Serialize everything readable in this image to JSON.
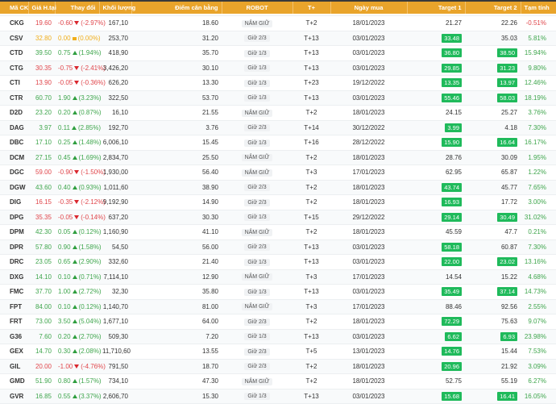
{
  "colors": {
    "header": "#e9a42b",
    "up": "#3fa64d",
    "down": "#e0464b",
    "flat": "#f0ae1b",
    "badge": "#1fba5b"
  },
  "headers": [
    "Mã CK",
    "Giá H.tại",
    "Thay đổi",
    "Khối lượng",
    "Điểm cân bằng",
    "ROBOT",
    "T+",
    "Ngày mua",
    "Target 1",
    "Target 2",
    "Tạm tính"
  ],
  "rows": [
    {
      "sym": "CKG",
      "price": "19.60",
      "chg": "-0.60",
      "pct": "(-2.97%)",
      "dir": "down",
      "vol": "167,10",
      "bal": "18.60",
      "robot": "NẮM GIỮ",
      "t": "T+2",
      "date": "18/01/2023",
      "t1": "21.27",
      "t1hit": false,
      "t2": "22.26",
      "t2hit": false,
      "pl": "-0.51%"
    },
    {
      "sym": "CSV",
      "price": "32.80",
      "chg": "0.00",
      "pct": "(0.00%)",
      "dir": "flat",
      "vol": "253,70",
      "bal": "31.20",
      "robot": "Giữ 2/3",
      "t": "T+13",
      "date": "03/01/2023",
      "t1": "33.48",
      "t1hit": true,
      "t2": "35.03",
      "t2hit": false,
      "pl": "5.81%"
    },
    {
      "sym": "CTD",
      "price": "39.50",
      "chg": "0.75",
      "pct": "(1.94%)",
      "dir": "up",
      "vol": "418,90",
      "bal": "35.70",
      "robot": "Giữ 1/3",
      "t": "T+13",
      "date": "03/01/2023",
      "t1": "36.80",
      "t1hit": true,
      "t2": "38.50",
      "t2hit": true,
      "pl": "15.94%"
    },
    {
      "sym": "CTG",
      "price": "30.35",
      "chg": "-0.75",
      "pct": "(-2.41%)",
      "dir": "down",
      "vol": "3,426,20",
      "bal": "30.10",
      "robot": "Giữ 1/3",
      "t": "T+13",
      "date": "03/01/2023",
      "t1": "29.85",
      "t1hit": true,
      "t2": "31.23",
      "t2hit": true,
      "pl": "9.80%"
    },
    {
      "sym": "CTI",
      "price": "13.90",
      "chg": "-0.05",
      "pct": "(-0.36%)",
      "dir": "down",
      "vol": "626,20",
      "bal": "13.30",
      "robot": "Giữ 1/3",
      "t": "T+23",
      "date": "19/12/2022",
      "t1": "13.35",
      "t1hit": true,
      "t2": "13.97",
      "t2hit": true,
      "pl": "12.46%"
    },
    {
      "sym": "CTR",
      "price": "60.70",
      "chg": "1.90",
      "pct": "(3.23%)",
      "dir": "up",
      "vol": "322,50",
      "bal": "53.70",
      "robot": "Giữ 1/3",
      "t": "T+13",
      "date": "03/01/2023",
      "t1": "55.46",
      "t1hit": true,
      "t2": "58.03",
      "t2hit": true,
      "pl": "18.19%"
    },
    {
      "sym": "D2D",
      "price": "23.20",
      "chg": "0.20",
      "pct": "(0.87%)",
      "dir": "up",
      "vol": "16,10",
      "bal": "21.55",
      "robot": "NẮM GIỮ",
      "t": "T+2",
      "date": "18/01/2023",
      "t1": "24.15",
      "t1hit": false,
      "t2": "25.27",
      "t2hit": false,
      "pl": "3.76%"
    },
    {
      "sym": "DAG",
      "price": "3.97",
      "chg": "0.11",
      "pct": "(2.85%)",
      "dir": "up",
      "vol": "192,70",
      "bal": "3.76",
      "robot": "Giữ 2/3",
      "t": "T+14",
      "date": "30/12/2022",
      "t1": "3.99",
      "t1hit": true,
      "t2": "4.18",
      "t2hit": false,
      "pl": "7.30%"
    },
    {
      "sym": "DBC",
      "price": "17.10",
      "chg": "0.25",
      "pct": "(1.48%)",
      "dir": "up",
      "vol": "6,006,10",
      "bal": "15.45",
      "robot": "Giữ 1/3",
      "t": "T+16",
      "date": "28/12/2022",
      "t1": "15.90",
      "t1hit": true,
      "t2": "16.64",
      "t2hit": true,
      "pl": "16.17%"
    },
    {
      "sym": "DCM",
      "price": "27.15",
      "chg": "0.45",
      "pct": "(1.69%)",
      "dir": "up",
      "vol": "2,834,70",
      "bal": "25.50",
      "robot": "NẮM GIỮ",
      "t": "T+2",
      "date": "18/01/2023",
      "t1": "28.76",
      "t1hit": false,
      "t2": "30.09",
      "t2hit": false,
      "pl": "1.95%"
    },
    {
      "sym": "DGC",
      "price": "59.00",
      "chg": "-0.90",
      "pct": "(-1.50%)",
      "dir": "down",
      "vol": "1,930,00",
      "bal": "56.40",
      "robot": "NẮM GIỮ",
      "t": "T+3",
      "date": "17/01/2023",
      "t1": "62.95",
      "t1hit": false,
      "t2": "65.87",
      "t2hit": false,
      "pl": "1.22%"
    },
    {
      "sym": "DGW",
      "price": "43.60",
      "chg": "0.40",
      "pct": "(0.93%)",
      "dir": "up",
      "vol": "1,011,60",
      "bal": "38.90",
      "robot": "Giữ 2/3",
      "t": "T+2",
      "date": "18/01/2023",
      "t1": "43.74",
      "t1hit": true,
      "t2": "45.77",
      "t2hit": false,
      "pl": "7.65%"
    },
    {
      "sym": "DIG",
      "price": "16.15",
      "chg": "-0.35",
      "pct": "(-2.12%)",
      "dir": "down",
      "vol": "9,192,90",
      "bal": "14.90",
      "robot": "Giữ 2/3",
      "t": "T+2",
      "date": "18/01/2023",
      "t1": "16.93",
      "t1hit": true,
      "t2": "17.72",
      "t2hit": false,
      "pl": "3.00%"
    },
    {
      "sym": "DPG",
      "price": "35.35",
      "chg": "-0.05",
      "pct": "(-0.14%)",
      "dir": "down",
      "vol": "637,20",
      "bal": "30.30",
      "robot": "Giữ 1/3",
      "t": "T+15",
      "date": "29/12/2022",
      "t1": "29.14",
      "t1hit": true,
      "t2": "30.49",
      "t2hit": true,
      "pl": "31.02%"
    },
    {
      "sym": "DPM",
      "price": "42.30",
      "chg": "0.05",
      "pct": "(0.12%)",
      "dir": "up",
      "vol": "1,160,90",
      "bal": "41.10",
      "robot": "NẮM GIỮ",
      "t": "T+2",
      "date": "18/01/2023",
      "t1": "45.59",
      "t1hit": false,
      "t2": "47.7",
      "t2hit": false,
      "pl": "0.21%"
    },
    {
      "sym": "DPR",
      "price": "57.80",
      "chg": "0.90",
      "pct": "(1.58%)",
      "dir": "up",
      "vol": "54,50",
      "bal": "56.00",
      "robot": "Giữ 2/3",
      "t": "T+13",
      "date": "03/01/2023",
      "t1": "58.18",
      "t1hit": true,
      "t2": "60.87",
      "t2hit": false,
      "pl": "7.30%"
    },
    {
      "sym": "DRC",
      "price": "23.05",
      "chg": "0.65",
      "pct": "(2.90%)",
      "dir": "up",
      "vol": "332,60",
      "bal": "21.40",
      "robot": "Giữ 1/3",
      "t": "T+13",
      "date": "03/01/2023",
      "t1": "22.00",
      "t1hit": true,
      "t2": "23.02",
      "t2hit": true,
      "pl": "13.16%"
    },
    {
      "sym": "DXG",
      "price": "14.10",
      "chg": "0.10",
      "pct": "(0.71%)",
      "dir": "up",
      "vol": "7,114,10",
      "bal": "12.90",
      "robot": "NẮM GIỮ",
      "t": "T+3",
      "date": "17/01/2023",
      "t1": "14.54",
      "t1hit": false,
      "t2": "15.22",
      "t2hit": false,
      "pl": "4.68%"
    },
    {
      "sym": "FMC",
      "price": "37.70",
      "chg": "1.00",
      "pct": "(2.72%)",
      "dir": "up",
      "vol": "32,30",
      "bal": "35.80",
      "robot": "Giữ 1/3",
      "t": "T+13",
      "date": "03/01/2023",
      "t1": "35.49",
      "t1hit": true,
      "t2": "37.14",
      "t2hit": true,
      "pl": "14.73%"
    },
    {
      "sym": "FPT",
      "price": "84.00",
      "chg": "0.10",
      "pct": "(0.12%)",
      "dir": "up",
      "vol": "1,140,70",
      "bal": "81.00",
      "robot": "NẮM GIỮ",
      "t": "T+3",
      "date": "17/01/2023",
      "t1": "88.46",
      "t1hit": false,
      "t2": "92.56",
      "t2hit": false,
      "pl": "2.55%"
    },
    {
      "sym": "FRT",
      "price": "73.00",
      "chg": "3.50",
      "pct": "(5.04%)",
      "dir": "up",
      "vol": "1,677,10",
      "bal": "64.00",
      "robot": "Giữ 2/3",
      "t": "T+2",
      "date": "18/01/2023",
      "t1": "72.29",
      "t1hit": true,
      "t2": "75.63",
      "t2hit": false,
      "pl": "9.07%"
    },
    {
      "sym": "G36",
      "price": "7.60",
      "chg": "0.20",
      "pct": "(2.70%)",
      "dir": "up",
      "vol": "509,30",
      "bal": "7.20",
      "robot": "Giữ 1/3",
      "t": "T+13",
      "date": "03/01/2023",
      "t1": "6.62",
      "t1hit": true,
      "t2": "6.93",
      "t2hit": true,
      "pl": "23.98%"
    },
    {
      "sym": "GEX",
      "price": "14.70",
      "chg": "0.30",
      "pct": "(2.08%)",
      "dir": "up",
      "vol": "11,710,60",
      "bal": "13.55",
      "robot": "Giữ 2/3",
      "t": "T+5",
      "date": "13/01/2023",
      "t1": "14.76",
      "t1hit": true,
      "t2": "15.44",
      "t2hit": false,
      "pl": "7.53%"
    },
    {
      "sym": "GIL",
      "price": "20.00",
      "chg": "-1.00",
      "pct": "(-4.76%)",
      "dir": "down",
      "vol": "791,50",
      "bal": "18.70",
      "robot": "Giữ 2/3",
      "t": "T+2",
      "date": "18/01/2023",
      "t1": "20.96",
      "t1hit": true,
      "t2": "21.92",
      "t2hit": false,
      "pl": "3.09%"
    },
    {
      "sym": "GMD",
      "price": "51.90",
      "chg": "0.80",
      "pct": "(1.57%)",
      "dir": "up",
      "vol": "734,10",
      "bal": "47.30",
      "robot": "NẮM GIỮ",
      "t": "T+2",
      "date": "18/01/2023",
      "t1": "52.75",
      "t1hit": false,
      "t2": "55.19",
      "t2hit": false,
      "pl": "6.27%"
    },
    {
      "sym": "GVR",
      "price": "16.85",
      "chg": "0.55",
      "pct": "(3.37%)",
      "dir": "up",
      "vol": "2,606,70",
      "bal": "15.30",
      "robot": "Giữ 1/3",
      "t": "T+13",
      "date": "03/01/2023",
      "t1": "15.68",
      "t1hit": true,
      "t2": "16.41",
      "t2hit": true,
      "pl": "16.05%"
    }
  ]
}
